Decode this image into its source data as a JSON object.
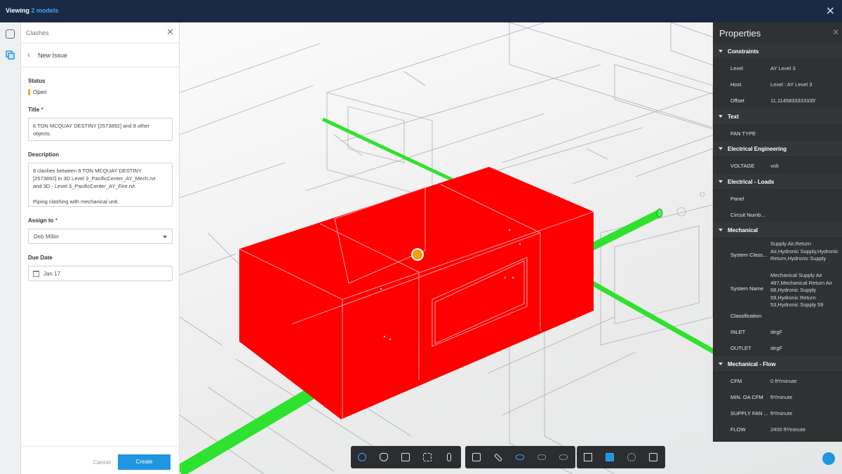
{
  "topbar": {
    "title_prefix": "Viewing",
    "title_models": "2 models"
  },
  "panel": {
    "header": "Clashes",
    "subheader": "New Issue",
    "status_label": "Status",
    "status_value": "Open",
    "title_label": "Title",
    "title_value": "6 TON MCQUAY DESTINY [2573892] and 8 other objects.",
    "description_label": "Description",
    "description_lines": [
      "8 clashes between 6 TON MCQUAY DESTINY",
      "[2573892] in 3D Level 3_PacificCenter_AY_Mech.rvt",
      "and 3D - Level 3_PacificCenter_AY_Fire.rvt",
      "",
      "Piping clashing with mechanical unit."
    ],
    "assign_label": "Assign to",
    "assign_value": "Deb Miller",
    "due_label": "Due Date",
    "due_value": "Jan 17",
    "cancel": "Cancel",
    "create": "Create"
  },
  "properties": {
    "title": "Properties",
    "sections": [
      {
        "name": "Constraints",
        "rows": [
          {
            "k": "Level",
            "v": "AY Level 3"
          },
          {
            "k": "Host",
            "v": "Level : AY Level 3"
          },
          {
            "k": "Offset",
            "v": "11.1145833333335'"
          }
        ]
      },
      {
        "name": "Text",
        "rows": [
          {
            "k": "FAN TYPE",
            "v": ""
          }
        ]
      },
      {
        "name": "Electrical Engineering",
        "rows": [
          {
            "k": "VOLTAGE",
            "v": "volt"
          }
        ]
      },
      {
        "name": "Electrical - Loads",
        "rows": [
          {
            "k": "Panel",
            "v": ""
          },
          {
            "k": "Circuit Numb...",
            "v": ""
          }
        ]
      },
      {
        "name": "Mechanical",
        "rows": [
          {
            "k": "System Class...",
            "v": "Supply Air,Return Air,Hydronic Supply,Hydronic Return,Hydronic Supply"
          },
          {
            "k": "System Name",
            "v": "Mechanical Supply Air 487,Mechanical Return Air 68,Hydronic Supply 59,Hydronic Return 53,Hydronic Supply 59"
          },
          {
            "k": "Classification",
            "v": ""
          },
          {
            "k": "INLET",
            "v": "degF"
          },
          {
            "k": "OUTLET",
            "v": "degF"
          }
        ]
      },
      {
        "name": "Mechanical - Flow",
        "rows": [
          {
            "k": "CFM",
            "v": "0 ft³/minute"
          },
          {
            "k": "MIN. OA CFM",
            "v": "ft³/minute"
          },
          {
            "k": "SUPPLY FAN ...",
            "v": "ft³/minute"
          },
          {
            "k": "FLOW",
            "v": "2400 ft³/minute"
          }
        ]
      }
    ]
  },
  "toolbar_groups": [
    [
      "orbit-icon",
      "pan-icon",
      "fit-view-icon",
      "zoom-window-icon",
      "walk-icon"
    ],
    [
      "section-box-icon",
      "measure-icon",
      "visibility-icon",
      "hide-icon",
      "isolate-icon"
    ],
    [
      "model-browser-icon",
      "properties-icon",
      "settings-icon",
      "fullscreen-icon"
    ]
  ],
  "colors": {
    "topbar": "#1a2a45",
    "accent": "#1e96e0",
    "clash": "#ff0000",
    "pipe": "#2fe22f",
    "status_open": "#f5a623",
    "marker": "#f5a000"
  }
}
